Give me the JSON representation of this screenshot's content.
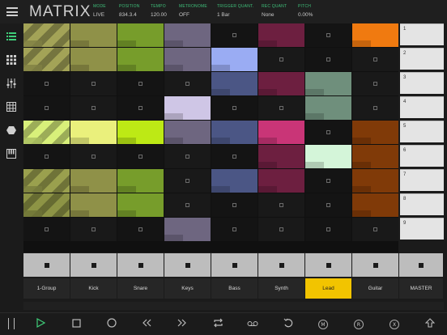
{
  "app": {
    "title": "MATRIX"
  },
  "header": {
    "fields": [
      {
        "label": "MODE",
        "value": "LIVE"
      },
      {
        "label": "POSITION",
        "value": "834.3.4"
      },
      {
        "label": "TEMPO",
        "value": "120.00"
      },
      {
        "label": "METRONOME",
        "value": "OFF"
      },
      {
        "label": "TRIGGER QUANT.",
        "value": "1 Bar"
      },
      {
        "label": "REC QUANT",
        "value": "None"
      },
      {
        "label": "PITCH",
        "value": "0.00%"
      }
    ]
  },
  "sidebar": {
    "icons": [
      "list-icon",
      "grid-icon",
      "mixer-icon",
      "matrix-grid-icon",
      "hexagon-icon",
      "piano-icon"
    ]
  },
  "tracks": [
    {
      "name": "1-Group",
      "clips": [
        "#a3a357:striped",
        "#a3a357:striped",
        "",
        "",
        "#d8f07a:striped",
        "",
        "#9aa04e:striped",
        "#8d9445:striped",
        ""
      ]
    },
    {
      "name": "Kick",
      "clips": [
        "#8f9148",
        "#8f9148",
        "",
        "",
        "#eaf07c",
        "",
        "#8f9148",
        "#8f9148",
        ""
      ]
    },
    {
      "name": "Snare",
      "clips": [
        "#779d2b",
        "#779d2b",
        "",
        "",
        "#bde915",
        "",
        "#779d2b",
        "#779d2b",
        ""
      ]
    },
    {
      "name": "Keys",
      "clips": [
        "#6e6680",
        "#6e6680",
        "",
        "#cfc6e6",
        "#6e6680",
        "",
        "",
        "",
        "#6e6680"
      ]
    },
    {
      "name": "Bass",
      "clips": [
        "",
        "#9aacf3",
        "#4b5685",
        "",
        "#4b5685",
        "",
        "#4b5685",
        "",
        ""
      ]
    },
    {
      "name": "Synth",
      "clips": [
        "#6d1f40",
        "",
        "#6d1f40",
        "",
        "#c93577",
        "#6d1f40",
        "#6d1f40",
        "",
        ""
      ]
    },
    {
      "name": "Lead",
      "clips": [
        "",
        "",
        "#6f8f7c",
        "#6f8f7c",
        "",
        "#d4f5d9",
        "",
        "",
        ""
      ]
    },
    {
      "name": "Guitar",
      "clips": [
        "#f07a10",
        "",
        "",
        "",
        "#803a08",
        "#803a08",
        "#803a08",
        "#803a08",
        ""
      ]
    }
  ],
  "master": {
    "name": "MASTER",
    "scenes": [
      "1",
      "2",
      "3",
      "4",
      "5",
      "6",
      "7",
      "8",
      "9"
    ]
  },
  "active_track": "Lead",
  "transport": [
    "play-icon",
    "stop-icon",
    "record-icon",
    "rewind-icon",
    "fast-forward-icon",
    "loop-icon",
    "tape-icon",
    "undo-icon",
    "metronome-icon",
    "overdub-icon",
    "crossfader-icon",
    "arrow-up-icon"
  ]
}
